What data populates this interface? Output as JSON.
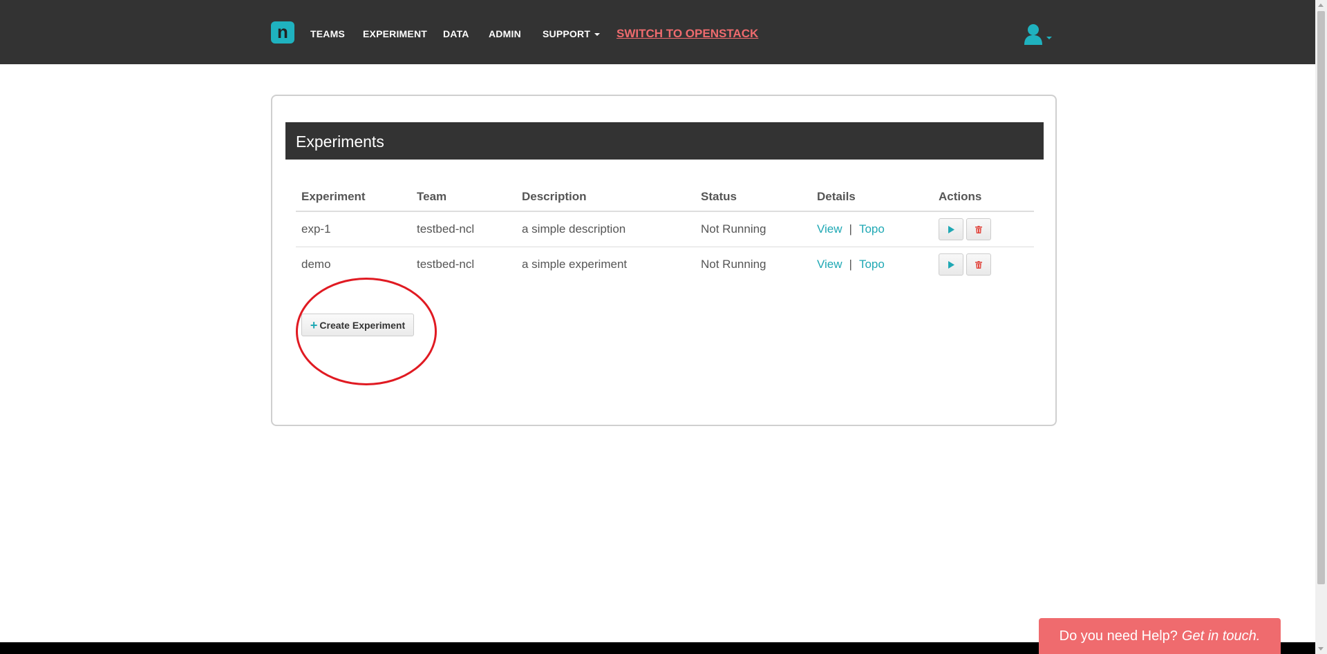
{
  "nav": {
    "logo_letter": "n",
    "items": [
      {
        "label": "TEAMS"
      },
      {
        "label": "EXPERIMENT"
      },
      {
        "label": "DATA"
      },
      {
        "label": "ADMIN"
      },
      {
        "label": "SUPPORT"
      }
    ],
    "openstack_label": "SWITCH TO OPENSTACK",
    "user_icon": "user-icon"
  },
  "panel": {
    "title": "Experiments",
    "columns": [
      "Experiment",
      "Team",
      "Description",
      "Status",
      "Details",
      "Actions"
    ],
    "rows": [
      {
        "experiment": "exp-1",
        "team": "testbed-ncl",
        "description": "a simple description",
        "status": "Not Running",
        "view": "View",
        "separator": "|",
        "topo": "Topo"
      },
      {
        "experiment": "demo",
        "team": "testbed-ncl",
        "description": "a simple experiment",
        "status": "Not Running",
        "view": "View",
        "separator": "|",
        "topo": "Topo"
      }
    ],
    "create_label": "Create Experiment",
    "create_plus": "+"
  },
  "help": {
    "text": "Do you need Help?",
    "link": "Get in touch."
  },
  "colors": {
    "nav_bg": "#333333",
    "accent": "#1fb2bf",
    "link": "#1fa8b4",
    "alert": "#ef6b6e",
    "annotation": "#e01a22"
  }
}
